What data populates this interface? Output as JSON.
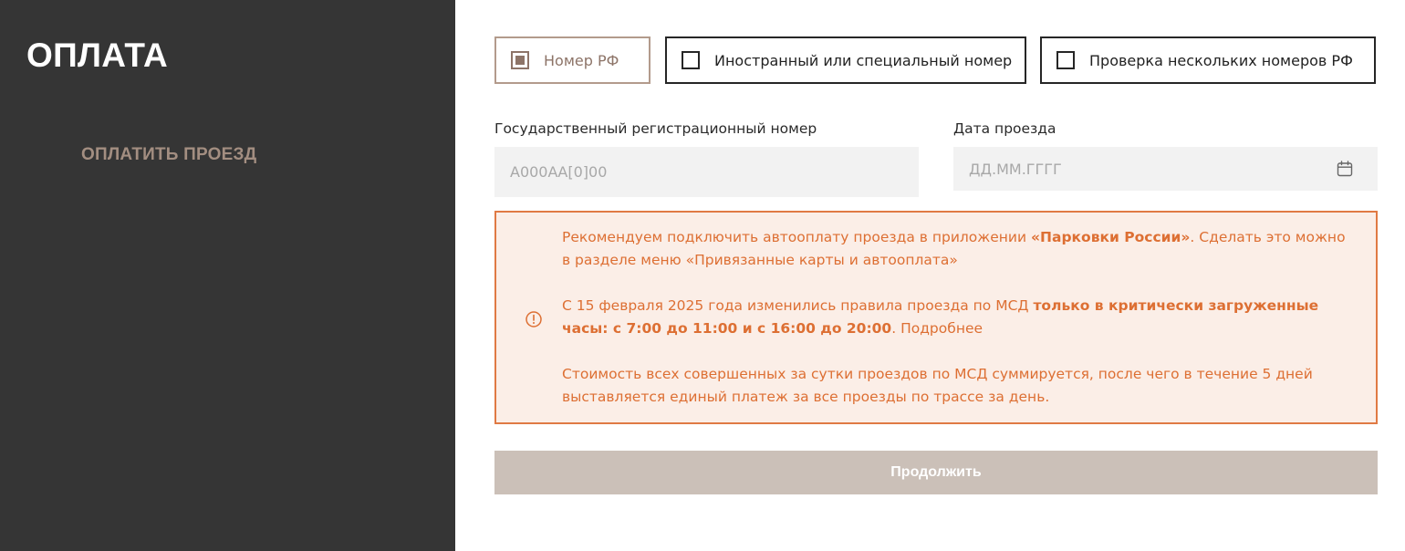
{
  "sidebar": {
    "title": "ОПЛАТА",
    "nav": [
      {
        "label": "ОПЛАТИТЬ ПРОЕЗД"
      }
    ]
  },
  "tabs": [
    {
      "label": "Номер РФ",
      "checked": true
    },
    {
      "label": "Иностранный или специальный номер",
      "checked": false
    },
    {
      "label": "Проверка нескольких номеров РФ",
      "checked": false
    }
  ],
  "form": {
    "plate": {
      "label": "Государственный регистрационный номер",
      "placeholder": "А000АА[0]00",
      "value": ""
    },
    "date": {
      "label": "Дата проезда",
      "placeholder": "ДД.ММ.ГГГГ",
      "value": "",
      "icon": "calendar-icon"
    }
  },
  "notice": {
    "icon": "alert-circle-icon",
    "color": "#dd6f33",
    "p1": {
      "a": "Рекомендуем подключить автооплату проезда в приложении ",
      "b": "«Парковки России»",
      "c": ". Сделать это можно в разделе меню «Привязанные карты и автооплата»"
    },
    "p2": {
      "a": "С 15 февраля 2025 года изменились правила проезда по МСД ",
      "b": "только в критически загруженные часы: с 7:00 до 11:00 и с 16:00 до 20:00",
      "c": ". ",
      "link": "Подробнее"
    },
    "p3": "Стоимость всех совершенных за сутки проездов по МСД суммируется, после чего в течение 5 дней выставляется единый платеж за все проезды по трассе за день."
  },
  "continue_button": {
    "label": "Продолжить",
    "color": "#cbc0b8"
  },
  "colors": {
    "sidebar_bg": "#353535",
    "accent_brown": "#8d7468",
    "warning_orange": "#e07a44"
  }
}
